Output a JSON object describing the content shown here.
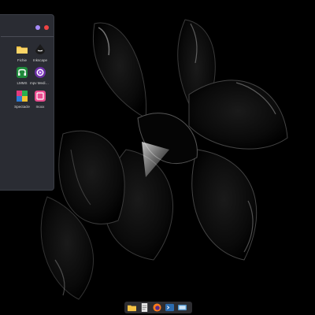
{
  "launcher": {
    "apps": [
      {
        "label": "",
        "icon": "partial-app-icon"
      },
      {
        "label": "Fichie",
        "icon": "folder-icon"
      },
      {
        "label": "Inkscape",
        "icon": "inkscape-icon"
      },
      {
        "label": "",
        "icon": "partial-app-icon"
      },
      {
        "label": "LMMS",
        "icon": "lmms-icon"
      },
      {
        "label": "mpv Media Pl...",
        "icon": "mpv-icon"
      },
      {
        "label": "",
        "icon": "partial-app-icon"
      },
      {
        "label": "Spectacle",
        "icon": "spectacle-icon"
      },
      {
        "label": "moxx",
        "icon": "moxx-icon"
      }
    ]
  },
  "dock": {
    "items": [
      "files-icon",
      "document-viewer-icon",
      "firefox-icon",
      "terminal-icon",
      "display-icon"
    ]
  },
  "colors": {
    "window": "#2a2c33",
    "minimize": "#a78bfa",
    "close": "#ef4444"
  }
}
